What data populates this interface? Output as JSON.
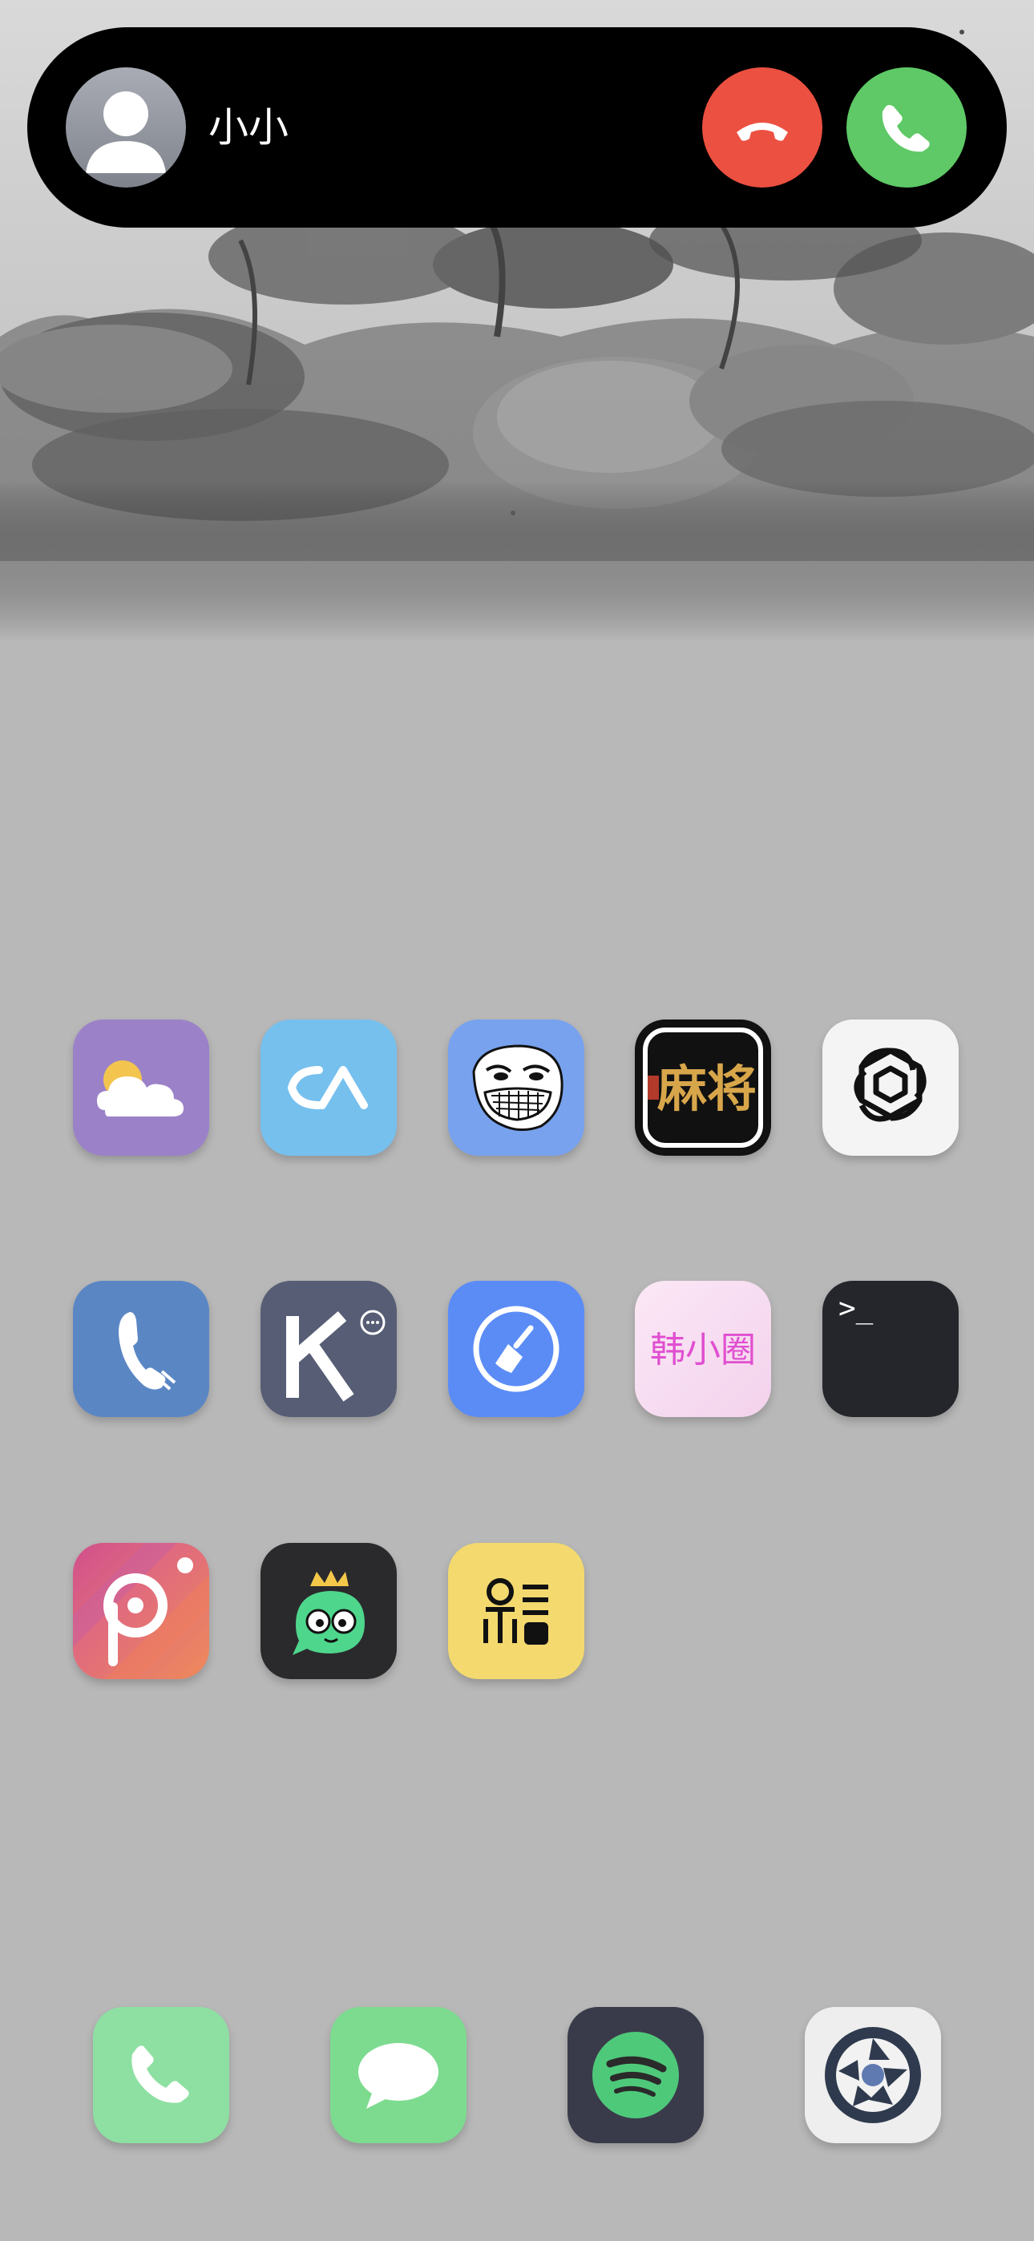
{
  "call": {
    "caller_name": "小小",
    "decline_icon": "phone-down-icon",
    "accept_icon": "phone-icon",
    "decline_color": "#ec5041",
    "accept_color": "#5ec966"
  },
  "apps": {
    "row1": [
      {
        "name": "weather",
        "icon": "cloud-sun-icon"
      },
      {
        "name": "ca-app",
        "icon": "ca-logo-icon"
      },
      {
        "name": "trollface",
        "icon": "trollface-icon"
      },
      {
        "name": "mahjong",
        "icon": "mahjong-icon",
        "label": "麻将"
      },
      {
        "name": "chatgpt",
        "icon": "openai-icon"
      }
    ],
    "row2": [
      {
        "name": "phone-alt",
        "icon": "handset-icon"
      },
      {
        "name": "k-app",
        "icon": "k-logo-icon"
      },
      {
        "name": "cleaner",
        "icon": "broom-icon"
      },
      {
        "name": "han-xiao-quan",
        "icon": "han-xiao-quan-icon",
        "label": "韩小圈"
      },
      {
        "name": "terminal",
        "icon": "terminal-icon",
        "label": ">_"
      }
    ],
    "row3": [
      {
        "name": "picsart",
        "icon": "picsart-icon"
      },
      {
        "name": "green-bubble",
        "icon": "crown-bubble-icon"
      },
      {
        "name": "yellow-app",
        "icon": "fm-logo-icon"
      }
    ]
  },
  "dock": [
    {
      "name": "phone",
      "icon": "phone-icon"
    },
    {
      "name": "messages",
      "icon": "message-bubble-icon"
    },
    {
      "name": "spotify",
      "icon": "spotify-icon"
    },
    {
      "name": "camera-app",
      "icon": "aperture-icon"
    }
  ]
}
